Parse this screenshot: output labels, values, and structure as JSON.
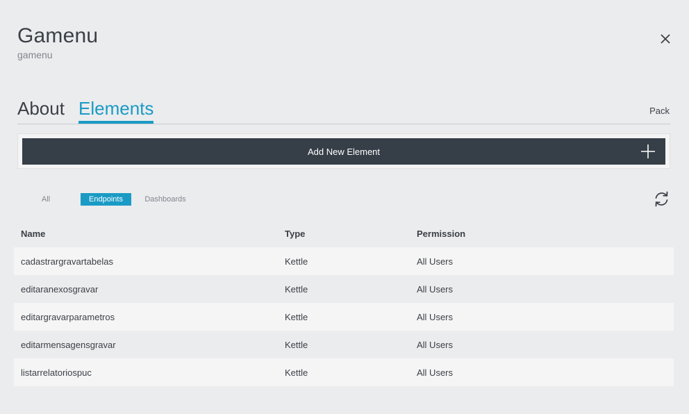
{
  "header": {
    "title": "Gamenu",
    "subtitle": "gamenu"
  },
  "tabs": [
    {
      "label": "About",
      "active": false
    },
    {
      "label": "Elements",
      "active": true
    }
  ],
  "pack_label": "Pack",
  "add_button_label": "Add New Element",
  "filters": [
    {
      "label": "All",
      "active": false
    },
    {
      "label": "Endpoints",
      "active": true
    },
    {
      "label": "Dashboards",
      "active": false
    }
  ],
  "table": {
    "columns": [
      "Name",
      "Type",
      "Permission"
    ],
    "rows": [
      {
        "name": "cadastrargravartabelas",
        "type": "Kettle",
        "permission": "All Users"
      },
      {
        "name": "editaranexosgravar",
        "type": "Kettle",
        "permission": "All Users"
      },
      {
        "name": "editargravarparametros",
        "type": "Kettle",
        "permission": "All Users"
      },
      {
        "name": "editarmensagensgravar",
        "type": "Kettle",
        "permission": "All Users"
      },
      {
        "name": "listarrelatoriospuc",
        "type": "Kettle",
        "permission": "All Users"
      }
    ]
  },
  "colors": {
    "accent": "#1a9bc5",
    "button_dark": "#363f47",
    "background": "#ebecee"
  },
  "icons": {
    "close": "close-icon",
    "add": "plus-icon",
    "refresh": "refresh-icon"
  }
}
